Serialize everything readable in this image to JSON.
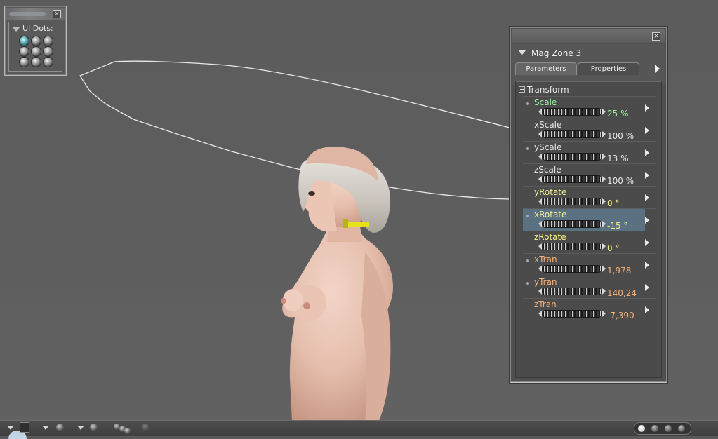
{
  "ui_dots": {
    "label": "UI Dots:",
    "dots_count": 9,
    "active_index": 0
  },
  "panel": {
    "actor_name": "Mag Zone 3",
    "tabs": [
      {
        "label": "Parameters",
        "active": true
      },
      {
        "label": "Properties",
        "active": false
      }
    ],
    "group_label": "Transform",
    "params": [
      {
        "name": "Scale",
        "value": "25 %",
        "name_color": "#9df09d",
        "value_color": "#9df09d",
        "keyed": true,
        "selected": false
      },
      {
        "name": "xScale",
        "value": "100 %",
        "name_color": "#e6e6e6",
        "value_color": "#e6e6e6",
        "keyed": false,
        "selected": false
      },
      {
        "name": "yScale",
        "value": "13 %",
        "name_color": "#e6e6e6",
        "value_color": "#e6e6e6",
        "keyed": true,
        "selected": false
      },
      {
        "name": "zScale",
        "value": "100 %",
        "name_color": "#e6e6e6",
        "value_color": "#e6e6e6",
        "keyed": false,
        "selected": false
      },
      {
        "name": "yRotate",
        "value": "0 °",
        "name_color": "#f4f08a",
        "value_color": "#f4f08a",
        "keyed": false,
        "selected": false
      },
      {
        "name": "xRotate",
        "value": "-15 °",
        "name_color": "#f4f08a",
        "value_color": "#f4f08a",
        "keyed": true,
        "selected": true
      },
      {
        "name": "zRotate",
        "value": "0 °",
        "name_color": "#f4f08a",
        "value_color": "#f4f08a",
        "keyed": false,
        "selected": false
      },
      {
        "name": "xTran",
        "value": "1,978",
        "name_color": "#f2b27a",
        "value_color": "#f2b27a",
        "keyed": true,
        "selected": false
      },
      {
        "name": "yTran",
        "value": "140,24",
        "name_color": "#f2b27a",
        "value_color": "#f2b27a",
        "keyed": true,
        "selected": false
      },
      {
        "name": "zTran",
        "value": "-7,390",
        "name_color": "#f2b27a",
        "value_color": "#f2b27a",
        "keyed": false,
        "selected": false
      }
    ]
  },
  "bottom_bar": {
    "icons": [
      "display-style-menu",
      "shading-menu",
      "lighting-menu",
      "tracking-balls",
      "memory-dots"
    ]
  }
}
